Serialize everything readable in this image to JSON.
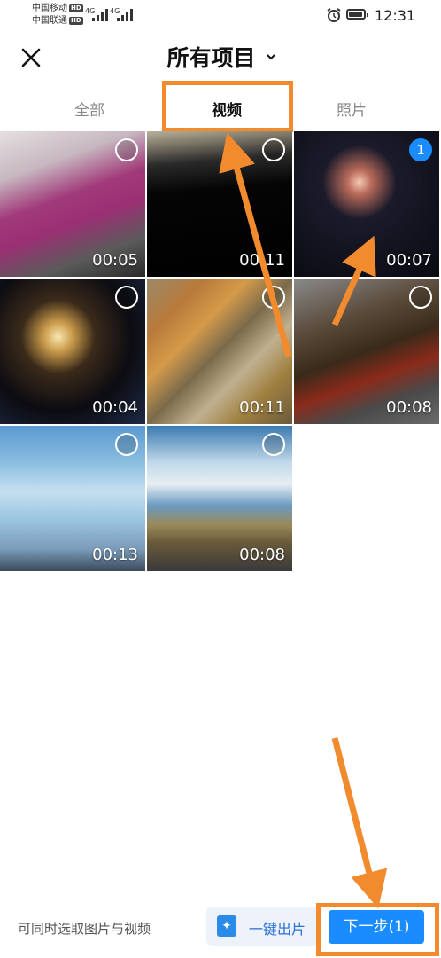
{
  "status_bar": {
    "carrier1": "中国移动",
    "carrier2": "中国联通",
    "hd_badge": "HD",
    "signal_label1": "4G",
    "signal_label2": "4G",
    "time": "12:31"
  },
  "header": {
    "title": "所有项目"
  },
  "tabs": [
    {
      "label": "全部",
      "active": false
    },
    {
      "label": "视频",
      "active": true
    },
    {
      "label": "照片",
      "active": false
    }
  ],
  "media": [
    {
      "duration": "00:05",
      "selected": false,
      "thumbnail": "pink-bedding-icon"
    },
    {
      "duration": "00:11",
      "selected": false,
      "thumbnail": "dark-video-icon"
    },
    {
      "duration": "00:07",
      "selected": true,
      "selection_number": "1",
      "thumbnail": "fireworks-icon"
    },
    {
      "duration": "00:04",
      "selected": false,
      "thumbnail": "fireworks-icon"
    },
    {
      "duration": "00:11",
      "selected": false,
      "thumbnail": "barbecue-food-icon"
    },
    {
      "duration": "00:08",
      "selected": false,
      "thumbnail": "grill-icon"
    },
    {
      "duration": "00:13",
      "selected": false,
      "thumbnail": "blue-sky-icon"
    },
    {
      "duration": "00:08",
      "selected": false,
      "thumbnail": "road-landscape-icon"
    }
  ],
  "bottom_bar": {
    "hint": "可同时选取图片与视频",
    "one_click_label": "一键出片",
    "next_label": "下一步(1)"
  },
  "colors": {
    "accent": "#1a8cff",
    "annotation": "#f28a2e"
  }
}
